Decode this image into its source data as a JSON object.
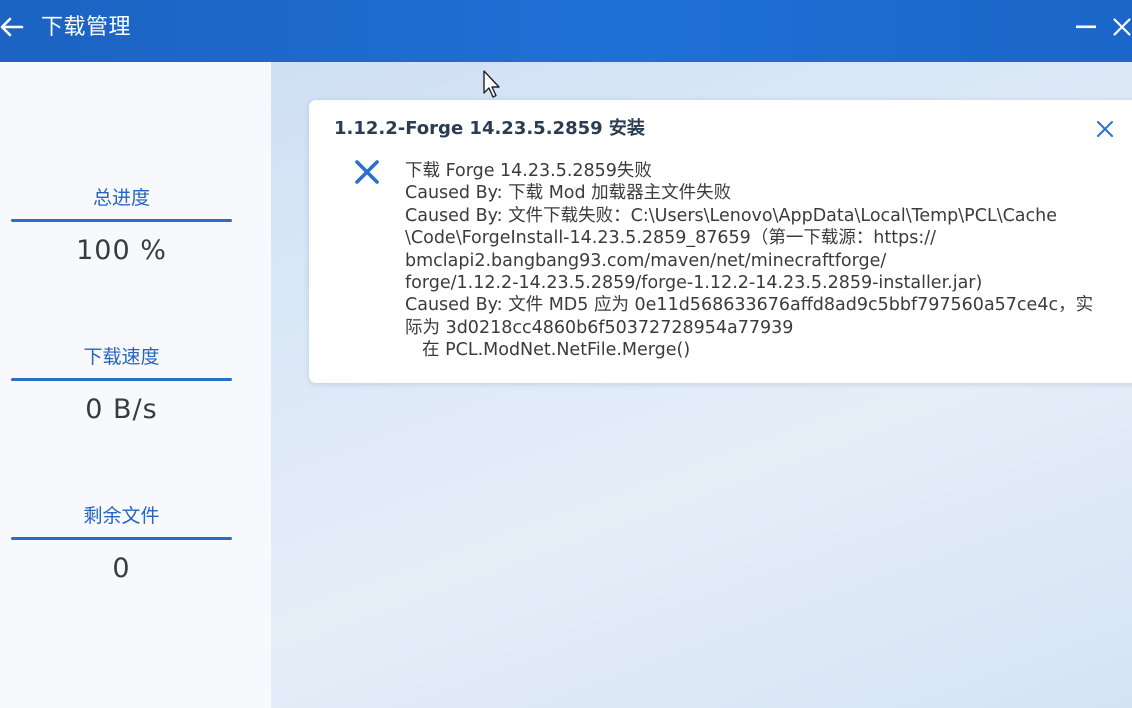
{
  "window": {
    "title": "下载管理"
  },
  "sidebar": {
    "stats": [
      {
        "label": "总进度",
        "value": "100 %"
      },
      {
        "label": "下载速度",
        "value": "0 B/s"
      },
      {
        "label": "剩余文件",
        "value": "0"
      }
    ]
  },
  "task": {
    "title": "1.12.2-Forge 14.23.5.2859 安装",
    "error_lines": [
      "下载 Forge 14.23.5.2859失败",
      "Caused By: 下载 Mod 加载器主文件失败",
      "Caused By: 文件下载失败：C:\\Users\\Lenovo\\AppData\\Local\\Temp\\PCL\\Cache",
      "\\Code\\ForgeInstall-14.23.5.2859_87659（第一下载源：https://",
      "bmclapi2.bangbang93.com/maven/net/minecraftforge/",
      "forge/1.12.2-14.23.5.2859/forge-1.12.2-14.23.5.2859-installer.jar)",
      "Caused By: 文件 MD5 应为 0e11d568633676affd8ad9c5bbf797560a57ce4c，实",
      "际为 3d0218cc4860b6f50372728954a77939",
      "在 PCL.ModNet.NetFile.Merge()"
    ]
  },
  "icons": {
    "back": "arrow-left-icon",
    "minimize": "minimize-icon",
    "close": "close-icon",
    "task_close": "close-icon",
    "error": "error-x-icon"
  },
  "colors": {
    "titlebar": "#1e6cd1",
    "accent": "#2565bd",
    "error": "#2b6fd0"
  }
}
